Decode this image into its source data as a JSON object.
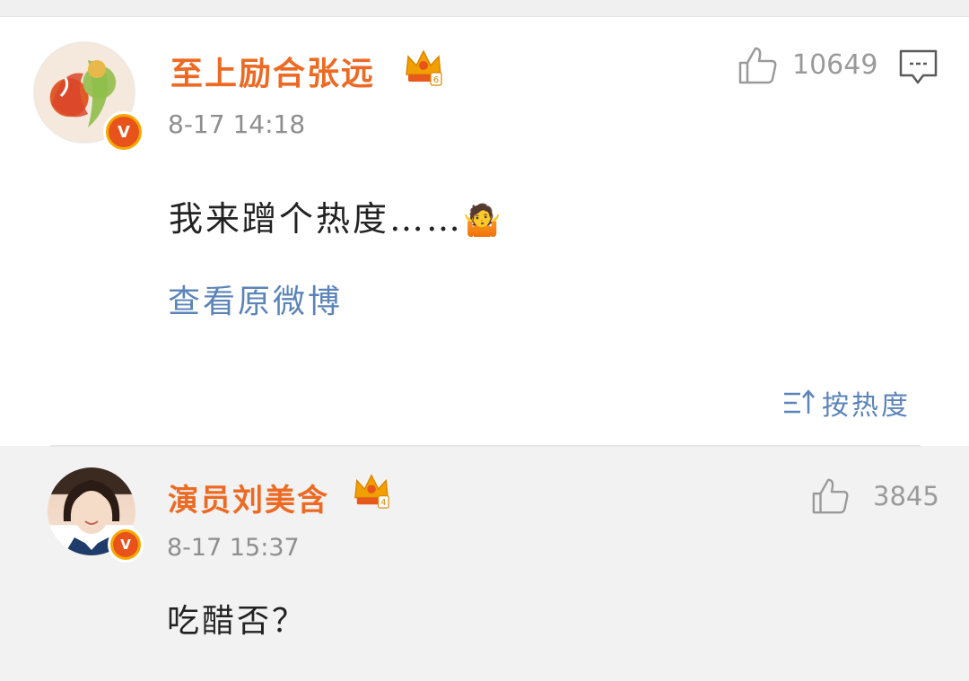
{
  "main_comment": {
    "username": "至上励合张远",
    "timestamp": "8-17 14:18",
    "text": "我来蹭个热度……",
    "emoji": "🤷",
    "likes": "10649",
    "view_original_label": "查看原微博",
    "verified_mark": "V"
  },
  "sort": {
    "label": "按热度"
  },
  "reply": {
    "username": "演员刘美含",
    "timestamp": "8-17 15:37",
    "text": "吃醋否？",
    "likes": "3845",
    "verified_mark": "V"
  },
  "colors": {
    "username": "#ec6a23",
    "link": "#5b84b8",
    "badge_outer": "#f7a800",
    "badge_inner": "#e8531b",
    "crown": "#f2a000"
  },
  "icons": {
    "like": "thumbs-up-icon",
    "comment": "comment-bubble-icon",
    "crown": "crown-icon",
    "sort": "sort-icon"
  }
}
